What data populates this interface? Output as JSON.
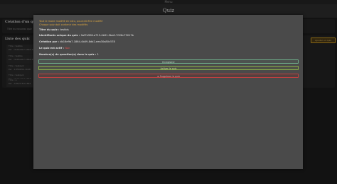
{
  "topbar": {
    "label": "Menu"
  },
  "header": {
    "title": "Quiz"
  },
  "background": {
    "create_card": {
      "title": "Création d'un quiz",
      "text": "Titre du nouveau quiz"
    },
    "list_card": {
      "title": "Liste des quiz",
      "add_button": "Ajouter un quiz"
    },
    "list_items": [
      {
        "line1": "Titre : testbis",
        "line2": "Par : db16e9b7-1864-4b09"
      },
      {
        "line1": "Titre : testbis",
        "line2": "Par : db16e9b7-1864-4b09"
      },
      {
        "line1": "Titre : testquiz",
        "line2": "Par : 13f5b854-1b48"
      },
      {
        "line1": "Titre : testquiz",
        "line2": "Par : db16e9b7-1864"
      },
      {
        "line1": "Titre : a",
        "line2": "Par : 3d5e5c8d-1864"
      }
    ]
  },
  "modal": {
    "warning_line1": "Tout le mode modifié en bleu, pourrait être modifié",
    "warning_line2": "Chaque quiz doit contenir des modifiés",
    "title_label": "Titre du quiz : ",
    "title_value": "testbis",
    "id_label": "Identifiants unique du quiz : ",
    "id_value": "0af7e906-a713-4b91-9ba0-7026c73017b",
    "creator_label": "Création par : ",
    "creator_value": "db16e9b7-1864-4b09-8db2-eea30a80c578",
    "active_label": "Le quiz est actif : ",
    "active_value": "Non",
    "count_label": "Nombre(s) de question(s) dans le quiz : ",
    "count_value": "1",
    "save_button": "Enregistrer",
    "hide_button": "Activer le quiz",
    "delete_button": "Supprimer le quiz"
  }
}
